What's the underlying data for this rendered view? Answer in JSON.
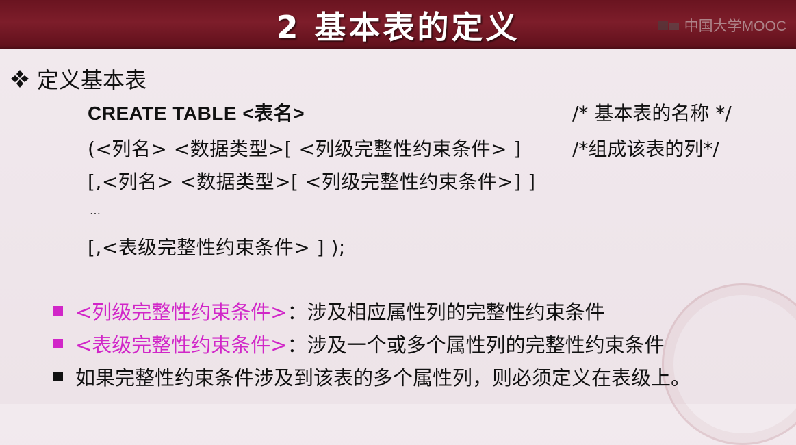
{
  "slide": {
    "title": "2 基本表的定义",
    "watermark": "中国大学MOOC"
  },
  "heading": "定义基本表",
  "syntax": {
    "line1": "CREATE TABLE <表名>",
    "line1_comment": "/* 基本表的名称 */",
    "line2": "(<列名> <数据类型>[ <列级完整性约束条件> ]",
    "line2_comment": "/*组成该表的列*/",
    "line3": "[,<列名> <数据类型>[ <列级完整性约束条件>] ]",
    "ellipsis": "…",
    "line5": "[,<表级完整性约束条件> ] );"
  },
  "bullets": [
    {
      "term": "<列级完整性约束条件>",
      "desc": "：涉及相应属性列的完整性约束条件",
      "color": "#d126c8"
    },
    {
      "term": "<表级完整性约束条件>",
      "desc": "：涉及一个或多个属性列的完整性约束条件",
      "color": "#d126c8"
    },
    {
      "term": "",
      "desc": "如果完整性约束条件涉及到该表的多个属性列，则必须定义在表级上。",
      "color": "#000000"
    }
  ],
  "colors": {
    "header_bg": "#7d1d2a",
    "accent_pink": "#d126c8",
    "text": "#111111"
  }
}
